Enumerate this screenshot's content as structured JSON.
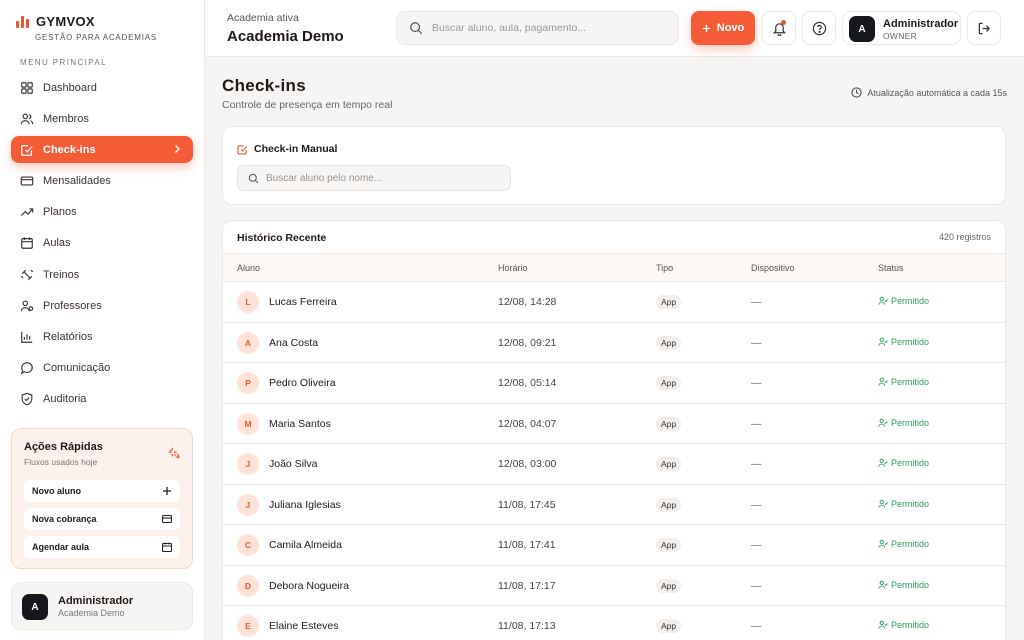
{
  "brand": {
    "name": "GYMVOX",
    "tagline": "GESTÃO PARA ACADEMIAS",
    "accent": "#f45c37"
  },
  "sidebar": {
    "section_label": "MENU PRINCIPAL",
    "items": [
      {
        "label": "Dashboard",
        "icon": "grid-icon"
      },
      {
        "label": "Membros",
        "icon": "users-icon"
      },
      {
        "label": "Check-ins",
        "icon": "checkbox-icon",
        "active": true
      },
      {
        "label": "Mensalidades",
        "icon": "card-icon"
      },
      {
        "label": "Planos",
        "icon": "trend-icon"
      },
      {
        "label": "Aulas",
        "icon": "calendar-icon"
      },
      {
        "label": "Treinos",
        "icon": "dumbbell-icon"
      },
      {
        "label": "Professores",
        "icon": "teacher-icon"
      },
      {
        "label": "Relatórios",
        "icon": "bar-chart-icon"
      },
      {
        "label": "Comunicação",
        "icon": "chat-icon"
      },
      {
        "label": "Auditoria",
        "icon": "shield-icon"
      }
    ],
    "quick_actions": {
      "title": "Ações Rápidas",
      "subtitle": "Fluxos usados hoje",
      "buttons": [
        {
          "label": "Novo aluno",
          "icon": "plus-icon"
        },
        {
          "label": "Nova cobrança",
          "icon": "card-icon"
        },
        {
          "label": "Agendar aula",
          "icon": "calendar-icon"
        }
      ]
    },
    "user": {
      "initial": "A",
      "name": "Administrador",
      "org": "Academia Demo"
    }
  },
  "header": {
    "gym_label": "Academia ativa",
    "gym_name": "Academia Demo",
    "search_placeholder": "Buscar aluno, aula, pagamento...",
    "new_label": "Novo",
    "admin": {
      "initial": "A",
      "name": "Administrador",
      "role": "OWNER"
    }
  },
  "page": {
    "title": "Check-ins",
    "subtitle": "Controle de presença em tempo real",
    "auto_update": "Atualização automática a cada 15s"
  },
  "manual_checkin": {
    "title": "Check-in Manual",
    "search_placeholder": "Buscar aluno pelo nome..."
  },
  "history": {
    "title": "Histórico Recente",
    "count": "420 registros",
    "columns": [
      "Aluno",
      "Horário",
      "Tipo",
      "Dispositivo",
      "Status"
    ],
    "status_color": "#2e9e5b",
    "rows": [
      {
        "initial": "L",
        "name": "Lucas Ferreira",
        "time": "12/08, 14:28",
        "type": "App",
        "device": "—",
        "status": "Permitido"
      },
      {
        "initial": "A",
        "name": "Ana Costa",
        "time": "12/08, 09:21",
        "type": "App",
        "device": "—",
        "status": "Permitido"
      },
      {
        "initial": "P",
        "name": "Pedro Oliveira",
        "time": "12/08, 05:14",
        "type": "App",
        "device": "—",
        "status": "Permitido"
      },
      {
        "initial": "M",
        "name": "Maria Santos",
        "time": "12/08, 04:07",
        "type": "App",
        "device": "—",
        "status": "Permitido"
      },
      {
        "initial": "J",
        "name": "João Silva",
        "time": "12/08, 03:00",
        "type": "App",
        "device": "—",
        "status": "Permitido"
      },
      {
        "initial": "J",
        "name": "Juliana Iglesias",
        "time": "11/08, 17:45",
        "type": "App",
        "device": "—",
        "status": "Permitido"
      },
      {
        "initial": "C",
        "name": "Camila Almeida",
        "time": "11/08, 17:41",
        "type": "App",
        "device": "—",
        "status": "Permitido"
      },
      {
        "initial": "D",
        "name": "Debora Nogueira",
        "time": "11/08, 17:17",
        "type": "App",
        "device": "—",
        "status": "Permitido"
      },
      {
        "initial": "E",
        "name": "Elaine Esteves",
        "time": "11/08, 17:13",
        "type": "App",
        "device": "—",
        "status": "Permitido"
      }
    ]
  }
}
